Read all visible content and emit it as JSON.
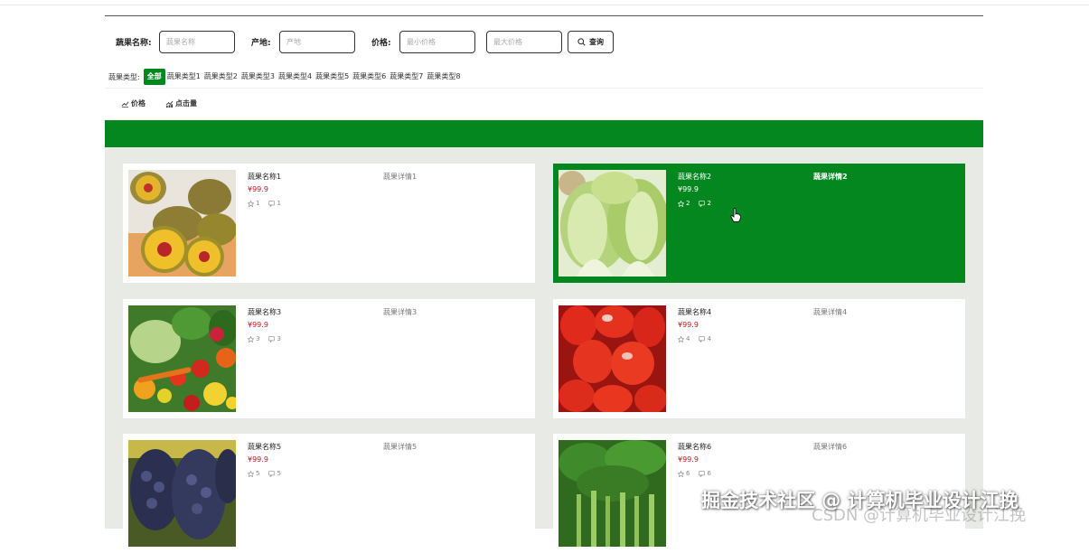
{
  "filters": {
    "name_label": "蔬果名称:",
    "name_placeholder": "蔬果名称",
    "origin_label": "产地:",
    "origin_placeholder": "产地",
    "price_label": "价格:",
    "min_price_placeholder": "最小价格",
    "max_price_placeholder": "最大价格",
    "search_label": "查询"
  },
  "types": {
    "label": "蔬果类型:",
    "items": [
      "全部",
      "蔬果类型1",
      "蔬果类型2",
      "蔬果类型3",
      "蔬果类型4",
      "蔬果类型5",
      "蔬果类型6",
      "蔬果类型7",
      "蔬果类型8"
    ],
    "active_index": 0
  },
  "sort": {
    "price_label": "价格",
    "clicks_label": "点击量"
  },
  "products": [
    {
      "name": "蔬果名称1",
      "detail": "蔬果详情1",
      "price": "¥99.9",
      "stars": "1",
      "comments": "1",
      "image": "kiwi-image"
    },
    {
      "name": "蔬果名称2",
      "detail": "蔬果详情2",
      "price": "¥99.9",
      "stars": "2",
      "comments": "2",
      "image": "cabbage-image"
    },
    {
      "name": "蔬果名称3",
      "detail": "蔬果详情3",
      "price": "¥99.9",
      "stars": "3",
      "comments": "3",
      "image": "vegetables-image"
    },
    {
      "name": "蔬果名称4",
      "detail": "蔬果详情4",
      "price": "¥99.9",
      "stars": "4",
      "comments": "4",
      "image": "strawberry-image"
    },
    {
      "name": "蔬果名称5",
      "detail": "蔬果详情5",
      "price": "¥99.9",
      "stars": "5",
      "comments": "5",
      "image": "grape-image"
    },
    {
      "name": "蔬果名称6",
      "detail": "蔬果详情6",
      "price": "¥99.9",
      "stars": "6",
      "comments": "6",
      "image": "celery-image"
    }
  ],
  "colors": {
    "brand": "#04871f",
    "price": "#c4161c",
    "grid_bg": "#e7eae5"
  },
  "watermark": {
    "main": "掘金技术社区 @ 计算机毕业设计江挽",
    "secondary": "CSDN @计算机毕业设计江挽"
  }
}
